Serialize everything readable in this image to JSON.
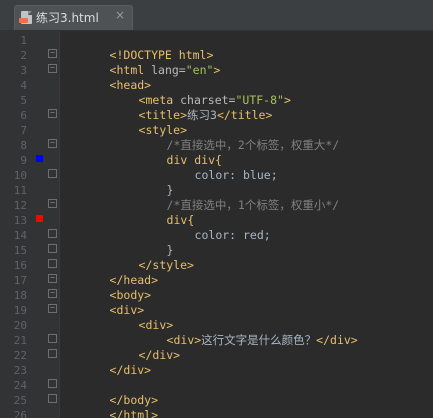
{
  "tab": {
    "title": "练习3.html",
    "close": "×"
  },
  "gutter": {
    "lines": [
      "1",
      "2",
      "3",
      "4",
      "5",
      "6",
      "7",
      "8",
      "9",
      "10",
      "11",
      "12",
      "13",
      "14",
      "15",
      "16",
      "17",
      "18",
      "19",
      "20",
      "21",
      "22",
      "23",
      "24",
      "25",
      "26"
    ]
  },
  "colors": {
    "blue_marker": "#0000ff",
    "red_marker": "#ff0000"
  },
  "code": {
    "l1": {
      "p1": "<!DOCTYPE html>"
    },
    "l2": {
      "p1": "<html ",
      "p2": "lang=",
      "p3": "\"en\"",
      "p4": ">"
    },
    "l3": {
      "p1": "<head>"
    },
    "l4": {
      "p1": "<meta ",
      "p2": "charset=",
      "p3": "\"UTF-8\"",
      "p4": ">"
    },
    "l5": {
      "p1": "<title>",
      "p2": "练习3",
      "p3": "</title>"
    },
    "l6": {
      "p1": "<style>"
    },
    "l7": {
      "p1": "/*直接选中，2个标签，权重大*/"
    },
    "l8": {
      "p1": "div div{"
    },
    "l9": {
      "p1": "color: blue;"
    },
    "l10": {
      "p1": "}"
    },
    "l11": {
      "p1": "/*直接选中，1个标签，权重小*/"
    },
    "l12": {
      "p1": "div{"
    },
    "l13": {
      "p1": "color: red;"
    },
    "l14": {
      "p1": "}"
    },
    "l15": {
      "p1": "</style>"
    },
    "l16": {
      "p1": "</head>"
    },
    "l17": {
      "p1": "<body>"
    },
    "l18": {
      "p1": "<div>"
    },
    "l19": {
      "p1": "<div>"
    },
    "l20": {
      "p1": "<div>",
      "p2": "这行文字是什么颜色？",
      "p3": "</div>"
    },
    "l21": {
      "p1": "</div>"
    },
    "l22": {
      "p1": "</div>"
    },
    "l24": {
      "p1": "</body>"
    },
    "l25": {
      "p1": "</html>"
    }
  }
}
